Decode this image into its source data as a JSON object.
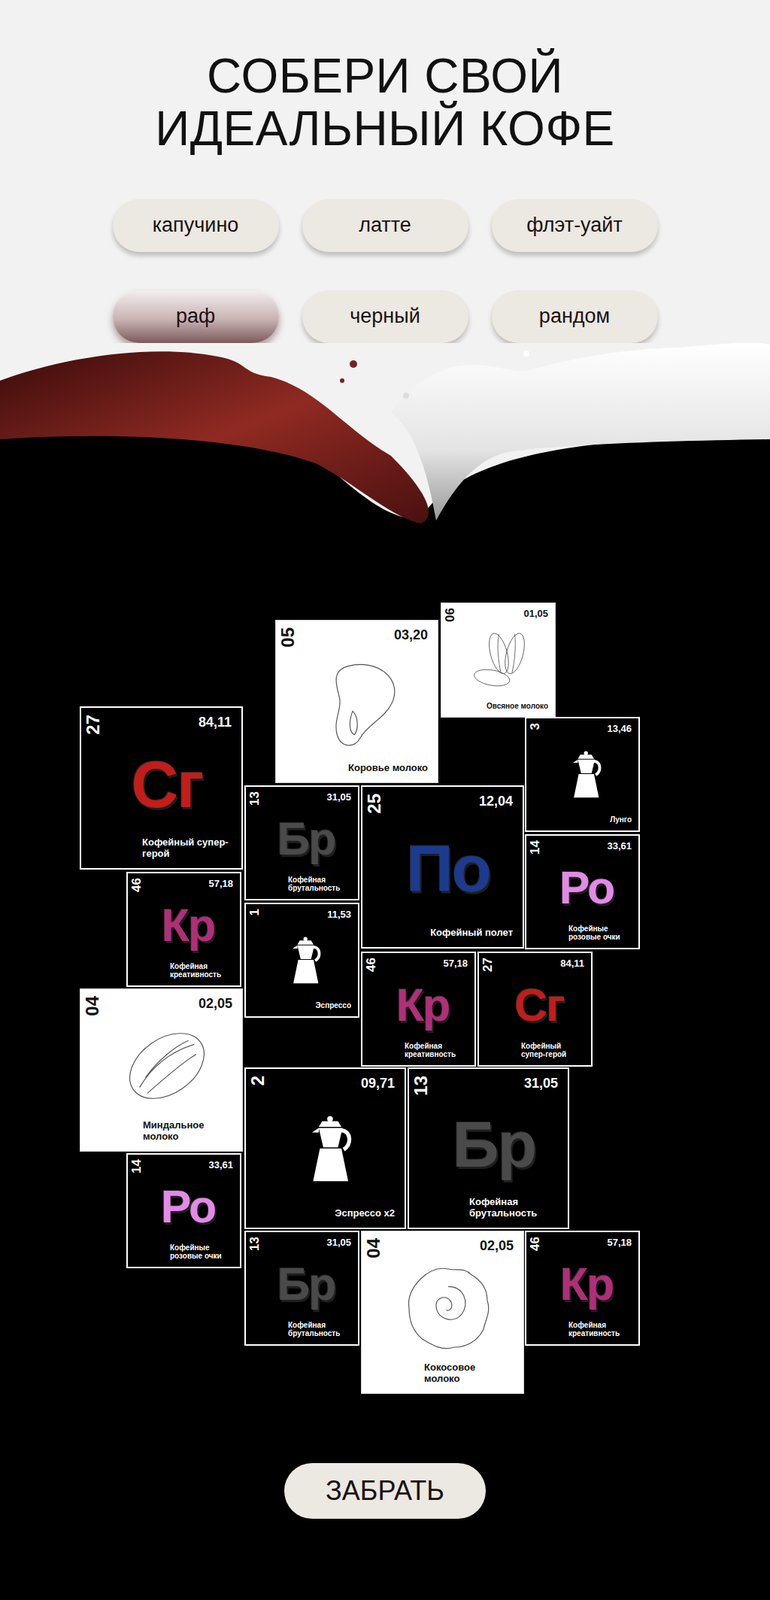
{
  "title": [
    "СОБЕРИ СВОЙ",
    "ИДЕАЛЬНЫЙ КОФЕ"
  ],
  "options": [
    {
      "label": "капучино",
      "selected": false
    },
    {
      "label": "латте",
      "selected": false
    },
    {
      "label": "флэт-уайт",
      "selected": false
    },
    {
      "label": "раф",
      "selected": true
    },
    {
      "label": "черный",
      "selected": false
    },
    {
      "label": "рандом",
      "selected": false
    }
  ],
  "tiles": [
    {
      "kind": "drop",
      "number": "05",
      "weight": "03,20",
      "name": "Коровье молоко"
    },
    {
      "kind": "beans",
      "number": "06",
      "weight": "01,05",
      "name": "Овсяное молоко"
    },
    {
      "kind": "symbol",
      "number": "27",
      "weight": "84,11",
      "symbol": "Cг",
      "color": "#c21d1a",
      "name": "Кофейный супер-герой"
    },
    {
      "kind": "symbol",
      "number": "13",
      "weight": "31,05",
      "symbol": "Бр",
      "color": "#4a4a4a",
      "name": "Кофейная брутальность"
    },
    {
      "kind": "symbol",
      "number": "25",
      "weight": "12,04",
      "symbol": "По",
      "color": "#1c3a8e",
      "name": "Кофейный полет"
    },
    {
      "kind": "pot",
      "number": "3",
      "weight": "13,46",
      "name": "Лунго"
    },
    {
      "kind": "symbol",
      "number": "14",
      "weight": "33,61",
      "symbol": "Ро",
      "color": "#e18ae6",
      "name": "Кофейные розовые очки"
    },
    {
      "kind": "symbol",
      "number": "46",
      "weight": "57,18",
      "symbol": "Кр",
      "color": "#b02f78",
      "name": "Кофейная креативность"
    },
    {
      "kind": "pot",
      "number": "1",
      "weight": "11,53",
      "name": "Эспрессо"
    },
    {
      "kind": "symbol",
      "number": "46",
      "weight": "57,18",
      "symbol": "Кр",
      "color": "#b02f78",
      "name": "Кофейная креативность"
    },
    {
      "kind": "symbol",
      "number": "27",
      "weight": "84,11",
      "symbol": "Cг",
      "color": "#c21d1a",
      "name": "Кофейный супер-герой"
    },
    {
      "kind": "almond",
      "number": "04",
      "weight": "02,05",
      "name": "Миндальное молоко"
    },
    {
      "kind": "pot",
      "number": "2",
      "weight": "09,71",
      "name": "Эспрессо x2"
    },
    {
      "kind": "symbol",
      "number": "13",
      "weight": "31,05",
      "symbol": "Бр",
      "color": "#4a4a4a",
      "name": "Кофейная брутальность"
    },
    {
      "kind": "symbol",
      "number": "14",
      "weight": "33,61",
      "symbol": "Ро",
      "color": "#e18ae6",
      "name": "Кофейные розовые очки"
    },
    {
      "kind": "symbol",
      "number": "13",
      "weight": "31,05",
      "symbol": "Бр",
      "color": "#4a4a4a",
      "name": "Кофейная брутальность"
    },
    {
      "kind": "coconut",
      "number": "04",
      "weight": "02,05",
      "name": "Кокосовое молоко"
    },
    {
      "kind": "symbol",
      "number": "46",
      "weight": "57,18",
      "symbol": "Кр",
      "color": "#b02f78",
      "name": "Кофейная креативность"
    }
  ],
  "action": "ЗАБРАТЬ"
}
